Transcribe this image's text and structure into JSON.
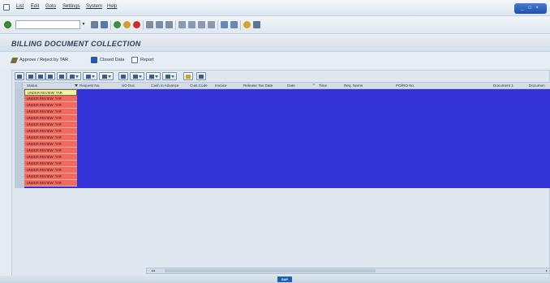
{
  "menu": {
    "items": [
      "List",
      "Edit",
      "Goto",
      "Settings",
      "System",
      "Help"
    ]
  },
  "window_controls": {
    "label": "_ □ ×"
  },
  "command_field": {
    "value": ""
  },
  "page": {
    "title": "BILLING DOCUMENT COLLECTION"
  },
  "app_toolbar": {
    "approve_label": "Approve / Reject by TAR",
    "closed_label": "Closed Data",
    "report_label": "Report"
  },
  "table": {
    "columns": [
      "Status",
      "Request No.",
      "SO Doc.",
      "Cash in Advance",
      "Cust.Code",
      "Invoice",
      "Release Tax Date",
      "Date",
      "Time",
      "Req. Name",
      "PO/RO No.",
      "Document 1",
      "Documen"
    ],
    "status_values": [
      "UNDER REVIEW: TAR",
      "UNDER REVIEW: TAR",
      "UNDER REVIEW: TAR",
      "UNDER REVIEW: TAR",
      "UNDER REVIEW: TAR",
      "UNDER REVIEW: TAR",
      "UNDER REVIEW: TAR",
      "UNDER REVIEW: TAR",
      "UNDER REVIEW: TAR",
      "UNDER REVIEW: TAR",
      "UNDER REVIEW: TAR",
      "UNDER REVIEW: TAR",
      "UNDER REVIEW: TAR",
      "UNDER REVIEW: TAR",
      "UNDER REVIEW: TAR"
    ]
  },
  "statusbar": {
    "logo": "SAP"
  },
  "colors": {
    "grid_selected": "#3232d6",
    "status_cell": "#f26a5e",
    "status_cell_selected": "#f7f39a"
  }
}
